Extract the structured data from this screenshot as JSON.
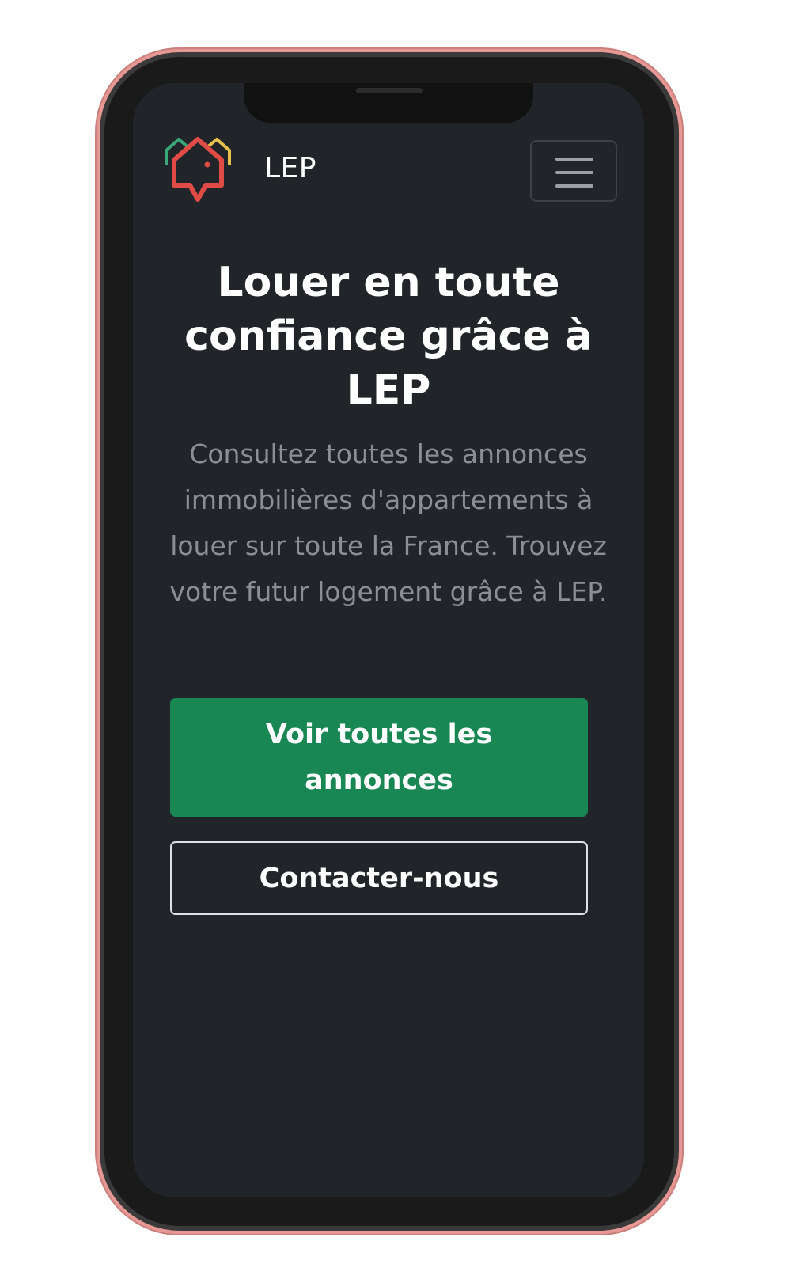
{
  "navbar": {
    "brand": "LEP",
    "logo_icon": "house-pin-logo-icon",
    "menu_icon": "hamburger-menu-icon"
  },
  "hero": {
    "title": "Louer en toute confiance grâce à LEP",
    "lead": "Consultez toutes les annonces immobilières d'appartements à louer sur toute la France. Trouvez votre futur logement grâce à LEP.",
    "primary_button": "Voir toutes les annonces",
    "secondary_button": "Contacter-nous"
  },
  "colors": {
    "background": "#212529",
    "primary": "#198754",
    "frame": "#e79894",
    "logo_red": "#e04b46",
    "logo_green": "#3aa77a",
    "logo_yellow": "#e6c24a"
  }
}
